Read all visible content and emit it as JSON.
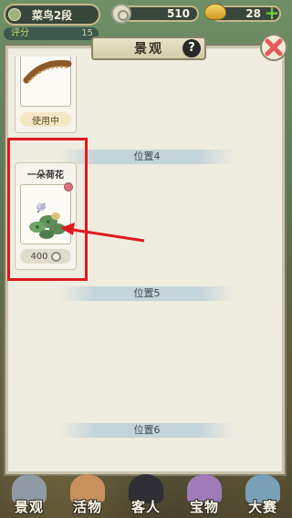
{
  "topbar": {
    "rank": "菜鸟2段",
    "score_label": "评分",
    "score_value": "15",
    "coins": "510",
    "ingots": "28",
    "plus": "+"
  },
  "panel": {
    "title": "景观",
    "help": "?"
  },
  "items": [
    {
      "status": "使用中"
    },
    {
      "name": "一朵荷花",
      "price": "400"
    }
  ],
  "sections": [
    "位置4",
    "位置5",
    "位置6"
  ],
  "bottom_nav": [
    "景观",
    "活物",
    "客人",
    "宝物",
    "大赛"
  ],
  "colors": {
    "highlight": "#e0191f",
    "panel_bg": "#efece0",
    "banner": "#c5d4da"
  }
}
